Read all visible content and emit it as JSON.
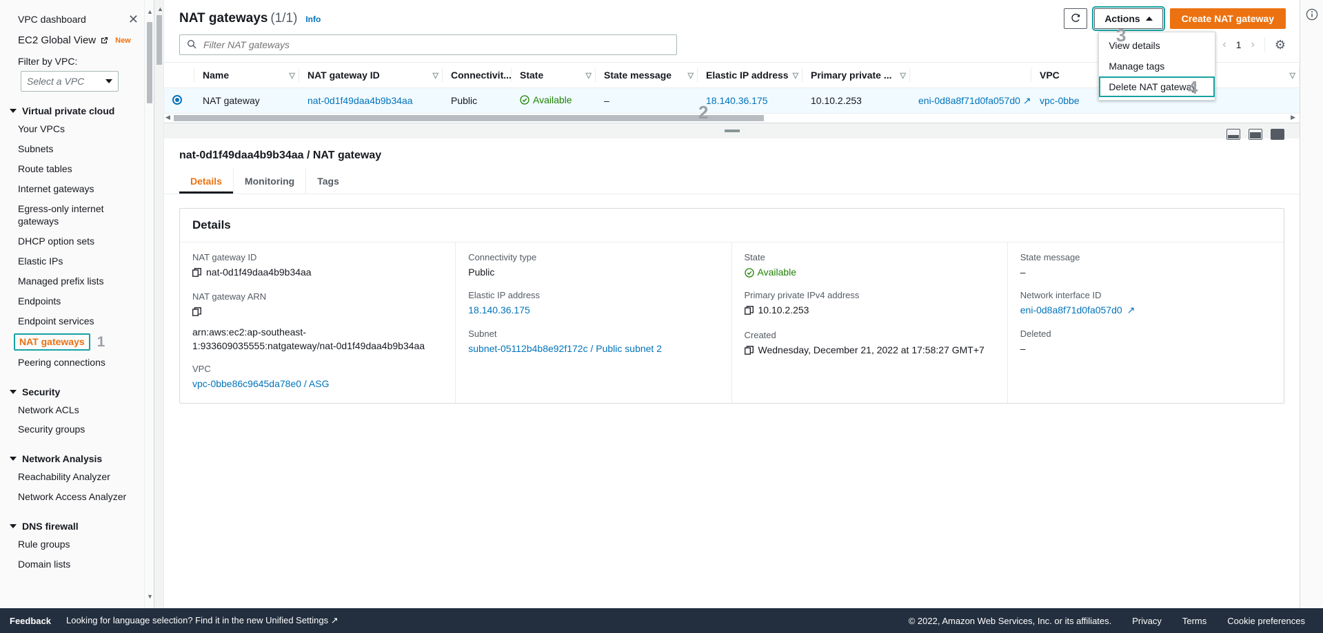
{
  "sidebar": {
    "title": "VPC dashboard",
    "close_icon": "close-icon",
    "global_view": "EC2 Global View",
    "global_view_badge": "New",
    "filter_label": "Filter by VPC:",
    "filter_placeholder": "Select a VPC",
    "groups": [
      {
        "title": "Virtual private cloud",
        "items": [
          {
            "label": "Your VPCs",
            "active": false
          },
          {
            "label": "Subnets",
            "active": false
          },
          {
            "label": "Route tables",
            "active": false
          },
          {
            "label": "Internet gateways",
            "active": false
          },
          {
            "label": "Egress-only internet gateways",
            "active": false
          },
          {
            "label": "DHCP option sets",
            "active": false
          },
          {
            "label": "Elastic IPs",
            "active": false
          },
          {
            "label": "Managed prefix lists",
            "active": false
          },
          {
            "label": "Endpoints",
            "active": false
          },
          {
            "label": "Endpoint services",
            "active": false
          },
          {
            "label": "NAT gateways",
            "active": true,
            "annotation": "1"
          },
          {
            "label": "Peering connections",
            "active": false
          }
        ]
      },
      {
        "title": "Security",
        "items": [
          {
            "label": "Network ACLs",
            "active": false
          },
          {
            "label": "Security groups",
            "active": false
          }
        ]
      },
      {
        "title": "Network Analysis",
        "items": [
          {
            "label": "Reachability Analyzer",
            "active": false
          },
          {
            "label": "Network Access Analyzer",
            "active": false
          }
        ]
      },
      {
        "title": "DNS firewall",
        "items": [
          {
            "label": "Rule groups",
            "active": false
          },
          {
            "label": "Domain lists",
            "active": false
          }
        ]
      }
    ]
  },
  "header": {
    "title": "NAT gateways",
    "count": "(1/1)",
    "info_label": "Info",
    "refresh_icon": "refresh-icon",
    "actions_label": "Actions",
    "actions_caret_icon": "caret-up-icon",
    "create_label": "Create NAT gateway",
    "actions_annotation": "3"
  },
  "actions_menu": {
    "items": [
      {
        "label": "View details",
        "highlighted": false
      },
      {
        "label": "Manage tags",
        "highlighted": false
      },
      {
        "label": "Delete NAT gateway",
        "highlighted": true
      }
    ],
    "annotation": "4"
  },
  "search": {
    "placeholder": "Filter NAT gateways",
    "value": "",
    "icon": "search-icon"
  },
  "pagination": {
    "prev_icon": "chevron-left-icon",
    "page": "1",
    "next_icon": "chevron-right-icon",
    "settings_icon": "gear-icon"
  },
  "table": {
    "columns": [
      "Name",
      "NAT gateway ID",
      "Connectivit...",
      "State",
      "State message",
      "Elastic IP address",
      "Primary private ...",
      "",
      "VPC"
    ],
    "rows": [
      {
        "selected": true,
        "name": "NAT gateway",
        "gateway_id": "nat-0d1f49daa4b9b34aa",
        "connectivity": "Public",
        "state": "Available",
        "state_message": "–",
        "elastic_ip": "18.140.36.175",
        "primary_private_ip": "10.10.2.253",
        "network_interface": "eni-0d8a8f71d0fa057d0",
        "vpc": "vpc-0bbe"
      }
    ],
    "row_annotation": "2"
  },
  "detail": {
    "heading": "nat-0d1f49daa4b9b34aa / NAT gateway",
    "tabs": [
      {
        "label": "Details",
        "active": true
      },
      {
        "label": "Monitoring",
        "active": false
      },
      {
        "label": "Tags",
        "active": false
      }
    ],
    "panel_title": "Details",
    "columns": [
      {
        "fields": [
          {
            "label": "NAT gateway ID",
            "value": "nat-0d1f49daa4b9b34aa",
            "copy": true,
            "link": false
          },
          {
            "label": "NAT gateway ARN",
            "value": "arn:aws:ec2:ap-southeast-1:933609035555:natgateway/nat-0d1f49daa4b9b34aa",
            "copy": true,
            "link": false
          },
          {
            "label": "VPC",
            "value": "vpc-0bbe86c9645da78e0 / ASG",
            "copy": false,
            "link": true
          }
        ]
      },
      {
        "fields": [
          {
            "label": "Connectivity type",
            "value": "Public",
            "copy": false,
            "link": false
          },
          {
            "label": "Elastic IP address",
            "value": "18.140.36.175",
            "copy": false,
            "link": true
          },
          {
            "label": "Subnet",
            "value": "subnet-05112b4b8e92f172c / Public subnet 2",
            "copy": false,
            "link": true
          }
        ]
      },
      {
        "fields": [
          {
            "label": "State",
            "value": "Available",
            "copy": false,
            "link": false,
            "status": true
          },
          {
            "label": "Primary private IPv4 address",
            "value": "10.10.2.253",
            "copy": true,
            "link": false
          },
          {
            "label": "Created",
            "value": "Wednesday, December 21, 2022 at 17:58:27 GMT+7",
            "copy": true,
            "link": false
          }
        ]
      },
      {
        "fields": [
          {
            "label": "State message",
            "value": "–",
            "copy": false,
            "link": false
          },
          {
            "label": "Network interface ID",
            "value": "eni-0d8a8f71d0fa057d0",
            "copy": false,
            "link": true,
            "external": true
          },
          {
            "label": "Deleted",
            "value": "–",
            "copy": false,
            "link": false
          }
        ]
      }
    ],
    "layout_icons": [
      "split-bottom-icon",
      "split-side-icon",
      "full-page-icon"
    ]
  },
  "footer": {
    "feedback": "Feedback",
    "language_note": "Looking for language selection? Find it in the new",
    "unified_settings": "Unified Settings",
    "copyright": "© 2022, Amazon Web Services, Inc. or its affiliates.",
    "privacy": "Privacy",
    "terms": "Terms",
    "cookie": "Cookie preferences"
  },
  "right_rail": {
    "info_icon": "info-circle-icon"
  },
  "colors": {
    "accent_orange": "#ec7211",
    "link_blue": "#0073bb",
    "highlight_teal": "#17a2a2",
    "status_green": "#1d8102",
    "footer_navy": "#232f3e"
  }
}
